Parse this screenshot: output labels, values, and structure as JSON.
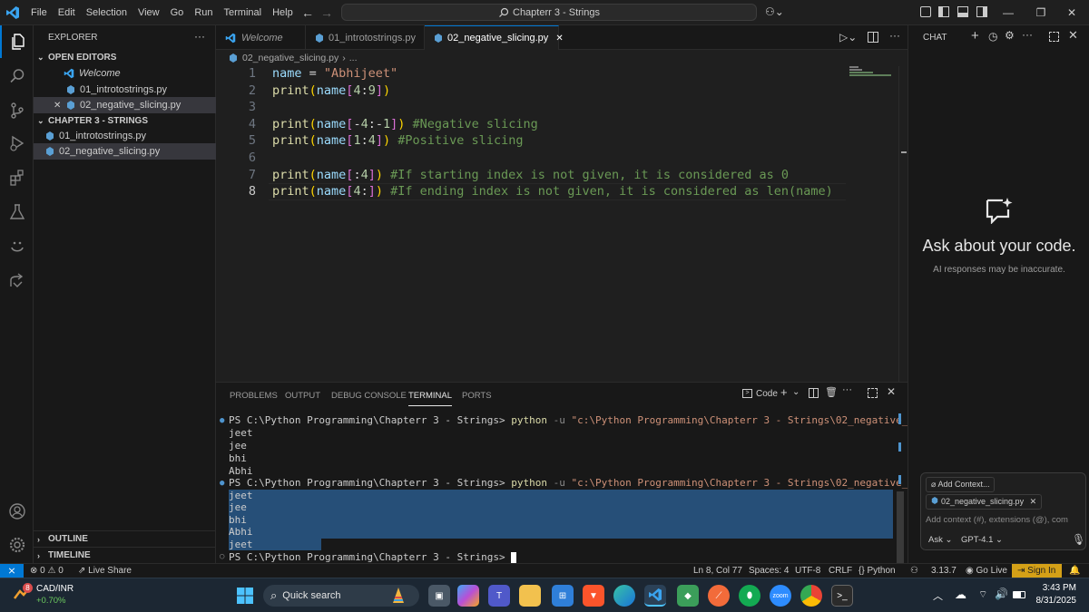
{
  "titlebar": {
    "menu": [
      "File",
      "Edit",
      "Selection",
      "View",
      "Go",
      "Run",
      "Terminal",
      "Help"
    ],
    "search_text": "Chapterr 3 - Strings"
  },
  "sidebar": {
    "title": "EXPLORER",
    "open_editors_label": "OPEN EDITORS",
    "open_editors": [
      "Welcome",
      "01_introtostrings.py",
      "02_negative_slicing.py"
    ],
    "folder_label": "CHAPTER 3 - STRINGS",
    "files": [
      "01_introtostrings.py",
      "02_negative_slicing.py"
    ],
    "outline_label": "OUTLINE",
    "timeline_label": "TIMELINE"
  },
  "tabs": [
    "Welcome",
    "01_introtostrings.py",
    "02_negative_slicing.py"
  ],
  "breadcrumb": {
    "file": "02_negative_slicing.py",
    "rest": "..."
  },
  "editor": {
    "line_numbers": [
      "1",
      "2",
      "3",
      "4",
      "5",
      "6",
      "7",
      "8"
    ],
    "cursor_line": 8
  },
  "panel": {
    "tabs": [
      "PROBLEMS",
      "OUTPUT",
      "DEBUG CONSOLE",
      "TERMINAL",
      "PORTS"
    ],
    "active_tab": "TERMINAL",
    "shell_label": "Code",
    "terminal": {
      "prompt": "PS C:\\Python Programming\\Chapterr 3 - Strings>",
      "cmd": "python",
      "flag": "-u",
      "path": "\"c:\\Python Programming\\Chapterr 3 - Strings\\02_negative_slicing.py\"",
      "output1": [
        "jeet",
        "jee",
        "bhi",
        "Abhi"
      ],
      "output2": [
        "jeet",
        "jee",
        "bhi",
        "Abhi",
        "jeet"
      ]
    }
  },
  "chat": {
    "title": "CHAT",
    "heading": "Ask about your code.",
    "subtext": "AI responses may be inaccurate.",
    "add_context": "Add Context...",
    "attached_file": "02_negative_slicing.py",
    "input_placeholder": "Add context (#), extensions (@), com",
    "mode": "Ask",
    "model": "GPT-4.1"
  },
  "statusbar": {
    "errors": "0",
    "warnings": "0",
    "live_share": "Live Share",
    "position": "Ln 8, Col 77",
    "spaces": "Spaces: 4",
    "encoding": "UTF-8",
    "eol": "CRLF",
    "language": "Python",
    "python_version": "3.13.7",
    "go_live": "Go Live",
    "sign_in": "Sign In"
  },
  "taskbar": {
    "stock_name": "CAD/INR",
    "stock_change": "+0.70%",
    "badge": "8",
    "search": "Quick search",
    "time": "3:43 PM",
    "date": "8/31/2025"
  }
}
